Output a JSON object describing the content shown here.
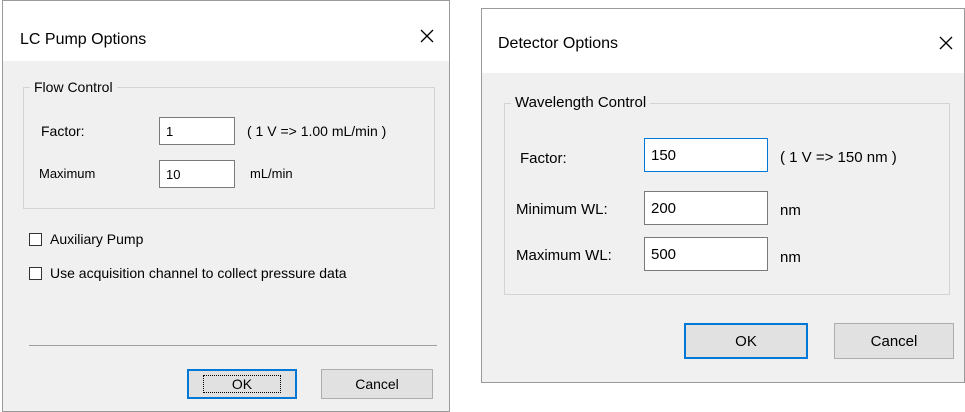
{
  "lc_dialog": {
    "title": "LC Pump Options",
    "flow_group": {
      "legend": "Flow Control",
      "factor_label": "Factor:",
      "factor_value": "1",
      "factor_hint": "( 1 V => 1.00 mL/min )",
      "maximum_label": "Maximum",
      "maximum_value": "10",
      "maximum_unit": "mL/min"
    },
    "aux_pump_label": "Auxiliary Pump",
    "aux_pump_checked": false,
    "pressure_label": "Use acquisition channel to collect pressure data",
    "pressure_checked": false,
    "ok_label": "OK",
    "cancel_label": "Cancel"
  },
  "detector_dialog": {
    "title": "Detector Options",
    "wl_group": {
      "legend": "Wavelength Control",
      "factor_label": "Factor:",
      "factor_value": "150",
      "factor_hint": "( 1 V => 150 nm )",
      "min_label": "Minimum WL:",
      "min_value": "200",
      "min_unit": "nm",
      "max_label": "Maximum WL:",
      "max_value": "500",
      "max_unit": "nm"
    },
    "ok_label": "OK",
    "cancel_label": "Cancel"
  },
  "colors": {
    "dialog_bg": "#f0f0f0",
    "title_bg": "#ffffff",
    "focus_accent": "#0078d7"
  },
  "icons": {
    "close": "close-icon"
  }
}
